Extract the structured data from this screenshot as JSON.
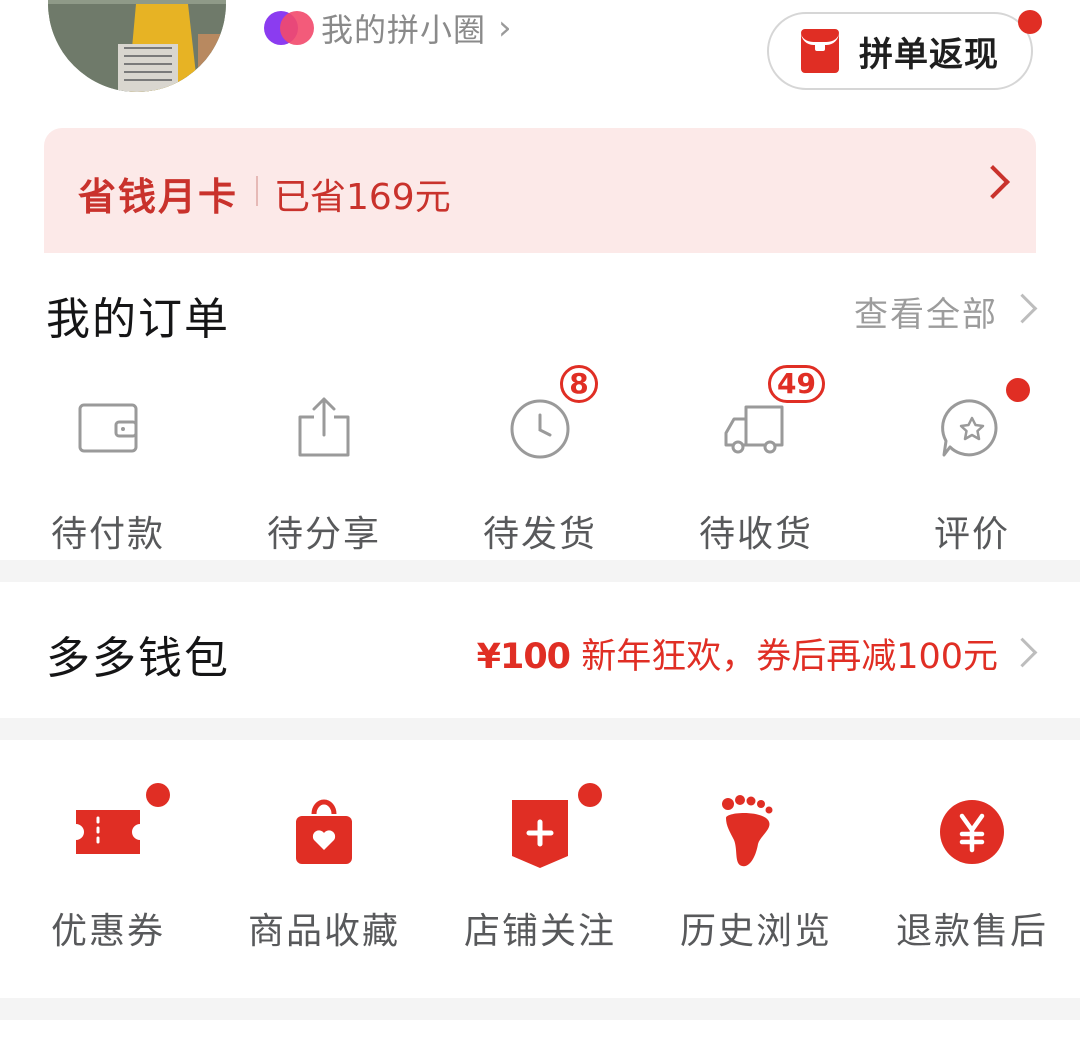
{
  "header": {
    "circle_label": "我的拼小圈",
    "cashback_label": "拼单返现"
  },
  "savings_card": {
    "title": "省钱月卡",
    "saved_text": "已省169元"
  },
  "orders": {
    "title": "我的订单",
    "view_all": "查看全部",
    "items": [
      {
        "label": "待付款",
        "icon": "wallet-icon"
      },
      {
        "label": "待分享",
        "icon": "share-icon"
      },
      {
        "label": "待发货",
        "icon": "clock-icon",
        "badge": "8"
      },
      {
        "label": "待收货",
        "icon": "truck-icon",
        "badge": "49"
      },
      {
        "label": "评价",
        "icon": "review-icon"
      }
    ]
  },
  "wallet": {
    "title": "多多钱包",
    "amount": "¥100",
    "promo": "新年狂欢，券后再减100元"
  },
  "tools": {
    "items": [
      {
        "label": "优惠券",
        "icon": "coupon-icon"
      },
      {
        "label": "商品收藏",
        "icon": "favorites-bag-icon"
      },
      {
        "label": "店铺关注",
        "icon": "store-follow-icon"
      },
      {
        "label": "历史浏览",
        "icon": "footprint-icon"
      },
      {
        "label": "退款售后",
        "icon": "refund-yen-icon"
      }
    ]
  },
  "colors": {
    "accent": "#e02e24",
    "card_bg": "#fce9e8",
    "text_primary": "#151516",
    "text_secondary": "#58595b"
  }
}
